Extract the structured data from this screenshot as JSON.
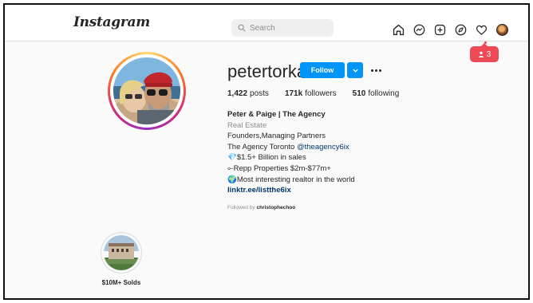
{
  "header": {
    "logo": "Instagram",
    "search_placeholder": "Search",
    "nav_icons": [
      "home-icon",
      "messenger-icon",
      "new-post-icon",
      "explore-icon",
      "activity-heart-icon",
      "profile-avatar"
    ],
    "notification_count": "3"
  },
  "profile": {
    "username": "petertorkan",
    "follow_label": "Follow",
    "stats": {
      "posts_count": "1,422",
      "posts_label": "posts",
      "followers_count": "171k",
      "followers_label": "followers",
      "following_count": "510",
      "following_label": "following"
    },
    "bio": {
      "name": "Peter & Paige | The Agency",
      "category": "Real Estate",
      "line1": "Founders,Managing Partners",
      "line2_text": "The Agency Toronto ",
      "line2_mention": "@theagency6ix",
      "line3_icon": "💎",
      "line3_text": "$1.5+ Billion in sales",
      "line4_icon": "⟜",
      "line4_text": "Repp Properties $2m-$77m+",
      "line5_icon": "🌍",
      "line5_text": "Most interesting realtor in the world",
      "link": "linktr.ee/listthe6ix"
    },
    "followed_by_prefix": "Followed by ",
    "followed_by_user": "christophechoo"
  },
  "highlights": [
    {
      "label": "$10M+ Solds"
    }
  ],
  "colors": {
    "accent": "#0095f6",
    "badge": "#ed4956",
    "link": "#00376b"
  }
}
